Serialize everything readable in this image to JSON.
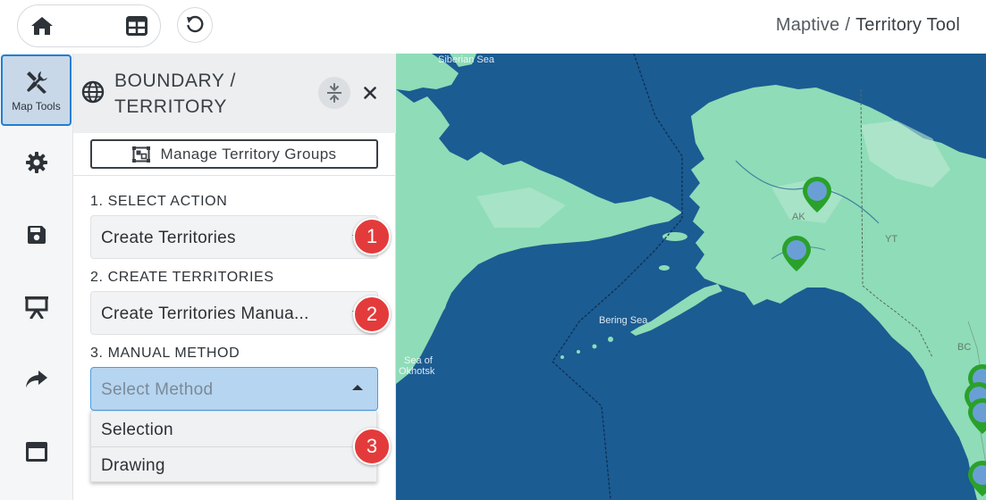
{
  "app": {
    "breadcrumb": {
      "parent": "Maptive",
      "separator": "/",
      "current": "Territory Tool"
    }
  },
  "view_switch": {
    "items": [
      {
        "name": "home",
        "icon": "home-icon",
        "active": false
      },
      {
        "name": "map",
        "icon": "map-icon",
        "active": true
      },
      {
        "name": "table",
        "icon": "table-icon",
        "active": false
      }
    ],
    "undo_icon": "undo-icon"
  },
  "rail": {
    "items": [
      {
        "label": "Map Tools",
        "icon": "map-tools-icon",
        "active": true
      },
      {
        "label": "",
        "icon": "gear-icon"
      },
      {
        "label": "",
        "icon": "save-icon"
      },
      {
        "label": "",
        "icon": "presentation-icon"
      },
      {
        "label": "",
        "icon": "share-icon"
      },
      {
        "label": "",
        "icon": "window-icon"
      }
    ]
  },
  "panel": {
    "title": "BOUNDARY / TERRITORY",
    "manage_button": "Manage Territory Groups",
    "step1": {
      "label": "1. SELECT ACTION",
      "value": "Create Territories",
      "badge": "1"
    },
    "step2": {
      "label": "2. CREATE TERRITORIES",
      "value": "Create Territories Manua...",
      "badge": "2"
    },
    "step3": {
      "label": "3. MANUAL METHOD",
      "placeholder": "Select Method",
      "options": [
        "Selection",
        "Drawing"
      ],
      "badge": "3"
    }
  },
  "map": {
    "labels": {
      "siberian_sea": "Siberian Sea",
      "bering_sea": "Bering Sea",
      "sea_of_okhotsk_1": "Sea of",
      "sea_of_okhotsk_2": "Okhotsk",
      "ak": "AK",
      "yt": "YT",
      "bc": "BC"
    },
    "colors": {
      "ocean": "#1b5c92",
      "land": "#8fdcb8",
      "pin": "#2aa12a",
      "pin_fill": "#6a9fd6"
    }
  }
}
